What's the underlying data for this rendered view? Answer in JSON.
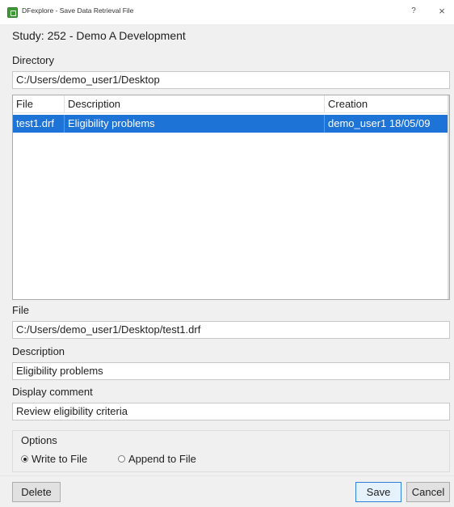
{
  "window": {
    "title": "DFexplore - Save Data Retrieval File",
    "help_label": "?",
    "close_label": "×"
  },
  "study_line": "Study: 252 - Demo A Development",
  "directory": {
    "label": "Directory",
    "value": "C:/Users/demo_user1/Desktop"
  },
  "file_list": {
    "columns": [
      "File",
      "Description",
      "Creation"
    ],
    "rows": [
      {
        "file": "test1.drf",
        "description": "Eligibility problems",
        "creation": "demo_user1 18/05/09",
        "selected": true
      }
    ]
  },
  "file_field": {
    "label": "File",
    "value": "C:/Users/demo_user1/Desktop/test1.drf"
  },
  "description_field": {
    "label": "Description",
    "value": "Eligibility problems"
  },
  "comment_field": {
    "label": "Display comment",
    "value": "Review eligibility criteria"
  },
  "options": {
    "title": "Options",
    "write_label": "Write to File",
    "append_label": "Append to File",
    "selected": "write"
  },
  "buttons": {
    "delete": "Delete",
    "save": "Save",
    "cancel": "Cancel"
  },
  "colors": {
    "selection": "#1e73d6",
    "app_icon": "#3f9b35",
    "default_button_border": "#2f7fd8"
  }
}
